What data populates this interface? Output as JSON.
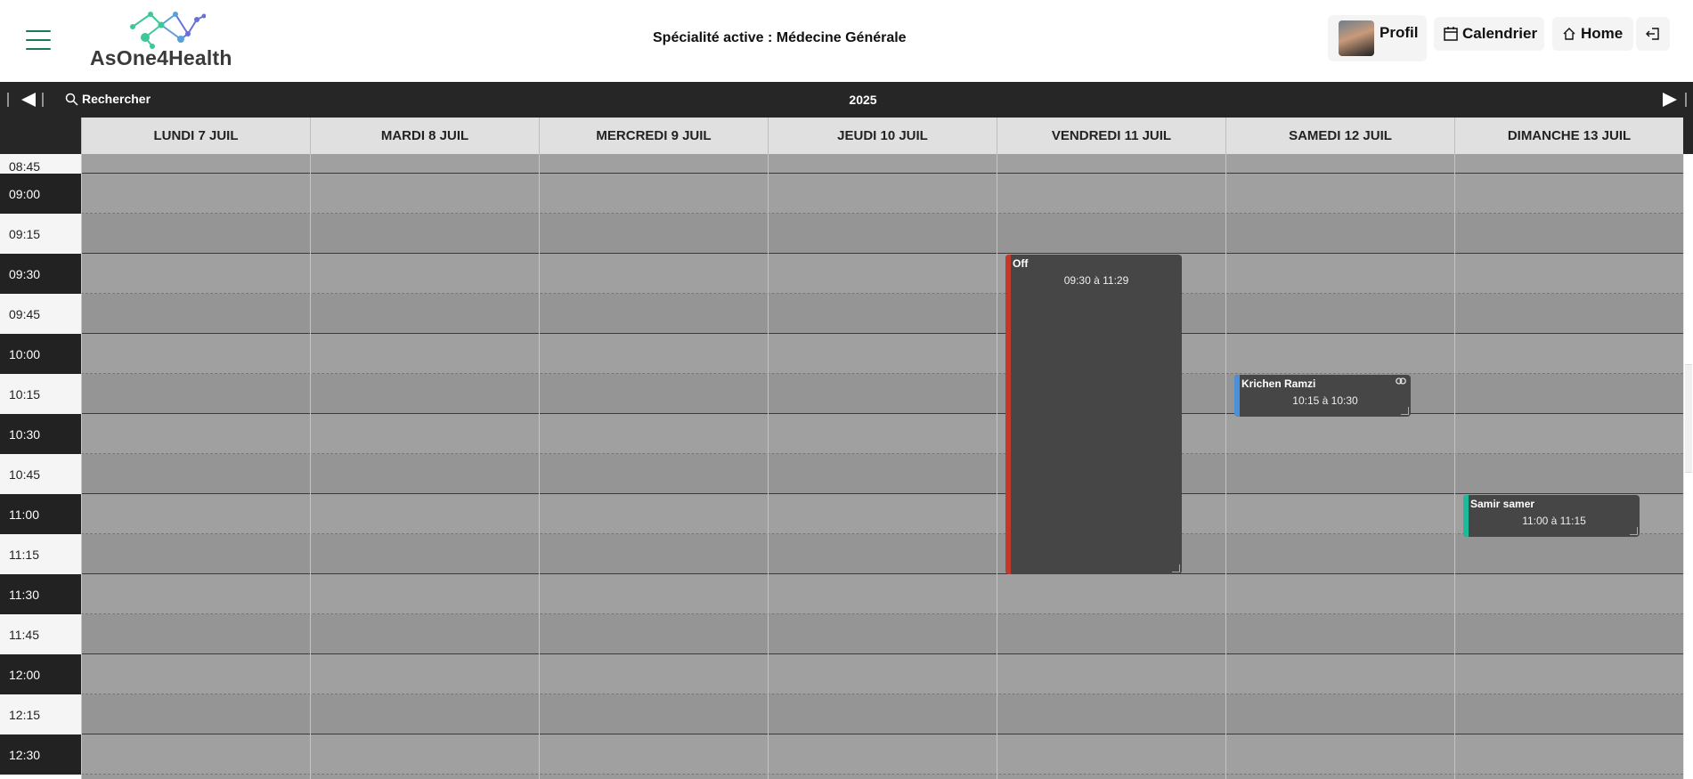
{
  "header": {
    "logo_text": "AsOne4Health",
    "specialty": "Spécialité active : Médecine Générale",
    "profile_label": "Profil",
    "calendar_label": "Calendrier",
    "home_label": "Home",
    "icons": {
      "menu": "hamburger-icon",
      "calendar": "calendar-icon",
      "home": "home-icon",
      "logout": "logout-icon",
      "search": "search-icon",
      "link": "link-icon"
    }
  },
  "nav": {
    "search_label": "Rechercher",
    "year": "2025"
  },
  "days": [
    "LUNDI 7 JUIL",
    "MARDI 8 JUIL",
    "MERCREDI 9 JUIL",
    "JEUDI 10 JUIL",
    "VENDREDI 11 JUIL",
    "SAMEDI 12 JUIL",
    "DIMANCHE 13 JUIL"
  ],
  "times": [
    "09:00",
    "09:15",
    "09:30",
    "09:45",
    "10:00",
    "10:15",
    "10:30",
    "10:45",
    "11:00",
    "11:15",
    "11:30",
    "11:45",
    "12:00",
    "12:15",
    "12:30"
  ],
  "partial_time": "08:45",
  "events": [
    {
      "title": "Off",
      "time": "09:30 à 11:29",
      "day": 4,
      "start": "09:30",
      "end": "11:29",
      "color": "#c0392b"
    },
    {
      "title": "Krichen Ramzi",
      "time": "10:15 à 10:30",
      "day": 5,
      "start": "10:15",
      "end": "10:30",
      "color": "#4a90d9",
      "linked": true
    },
    {
      "title": "Samir samer",
      "time": "11:00 à 11:15",
      "day": 6,
      "start": "11:00",
      "end": "11:15",
      "color": "#1abc9c"
    }
  ],
  "colors": {
    "accent": "#1b7a5a",
    "dark": "#262626",
    "grid": "#9a9a9a"
  }
}
